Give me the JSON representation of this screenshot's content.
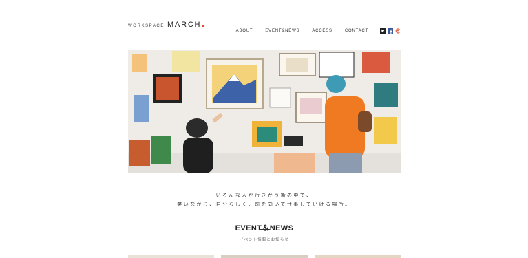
{
  "header": {
    "logo_small": "WORKSPACE",
    "logo_main": "MARCH"
  },
  "nav": {
    "items": [
      {
        "label": "ABOUT"
      },
      {
        "label": "EVENT&NEWS"
      },
      {
        "label": "ACCESS"
      },
      {
        "label": "CONTACT"
      }
    ],
    "icons": [
      "twitter-icon",
      "facebook-icon",
      "march-logo-icon"
    ]
  },
  "tagline": {
    "line1": "いろんな人が行きかう街の中で、",
    "line2": "笑いながら、自分らしく、前を向いて仕事していける場所。"
  },
  "section": {
    "title": "EVENT＆NEWS",
    "subtitle": "イベント情報とお知らせ"
  },
  "colors": {
    "accent": "#e04a2a",
    "facebook": "#3b5998",
    "text": "#222222"
  }
}
